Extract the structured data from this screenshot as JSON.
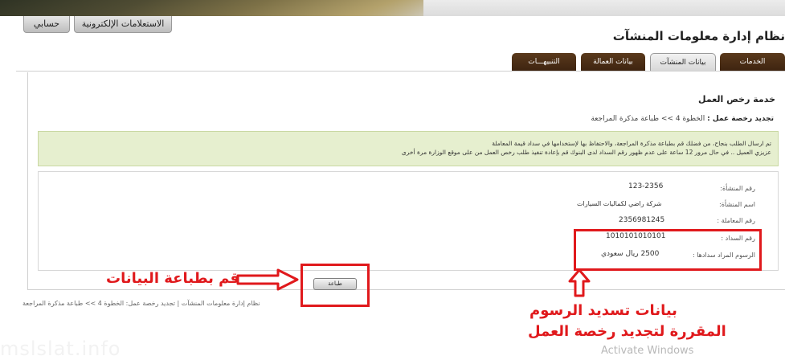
{
  "top_buttons": {
    "account": "حسابي",
    "inquiries": "الاستعلامات الإلكترونية"
  },
  "system_title": "نظام إدارة معلومات المنشآت",
  "tabs": [
    {
      "label": "الخدمات",
      "active": false
    },
    {
      "label": "بيانات المنشآت",
      "active": true
    },
    {
      "label": "بيانات العمالة",
      "active": false
    },
    {
      "label": "التنبيهـــات",
      "active": false
    }
  ],
  "page_title": "خدمة رخص العمل",
  "breadcrumb": {
    "prefix": "تجديد رخصة عمل :",
    "rest": "الخطوة 4 >> طباعة مذكرة المراجعة"
  },
  "notice": {
    "line1": "تم ارسال الطلب بنجاح، من فضلك قم بطباعة مذكرة المراجعة، والاحتفاظ بها لإستخدامها في سداد قيمة المعاملة",
    "line2": "عزيزي العميل .. في حال مرور 12 ساعة على عدم ظهور رقم السداد لدى البنوك قم بإعادة تنفيذ طلب رخص العمل من على موقع الوزارة مرة أخرى"
  },
  "details": [
    {
      "label": "رقم المنشأة:",
      "value": "123-2356"
    },
    {
      "label": "اسم المنشأة:",
      "value": "شركة راضي لكماليات السيارات"
    },
    {
      "label": "رقم المعاملة :",
      "value": "2356981245"
    },
    {
      "label": "رقم السداد :",
      "value": "1010101010101"
    },
    {
      "label": "الرسوم المراد سدادها :",
      "value": "2500 ريال سعودي"
    }
  ],
  "print_button": "طباعة",
  "annotations": {
    "print_note": "قم بطباعة البيانات",
    "fee_note_line1": "بيانات تسديد الرسوم",
    "fee_note_line2": "المقررة لتجديد رخصة العمل",
    "annotation_color": "#e0191c"
  },
  "footer_breadcrumb": "نظام إدارة معلومات المنشآت | تجديد رخصة عمل: الخطوة 4 >> طباعة مذكرة المراجعة",
  "watermark": "mslslat.info",
  "os_watermark": "Activate Windows"
}
